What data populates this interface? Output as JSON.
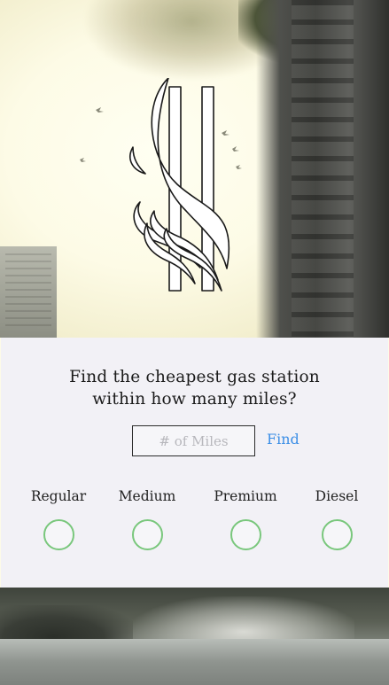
{
  "app": {
    "logo_icon": "gas-flame-logo-icon"
  },
  "search": {
    "question": "Find the cheapest gas station within how many miles?",
    "miles_value": "",
    "miles_placeholder": "# of Miles",
    "find_label": "Find"
  },
  "fuel_types": [
    {
      "label": "Regular",
      "selected": false
    },
    {
      "label": "Medium",
      "selected": false
    },
    {
      "label": "Premium",
      "selected": false
    },
    {
      "label": "Diesel",
      "selected": false
    }
  ],
  "colors": {
    "accent_link": "#3d8fe6",
    "radio_ring": "#79c77c",
    "card_background": "#f2f1f6",
    "text": "#1b1b1b"
  }
}
